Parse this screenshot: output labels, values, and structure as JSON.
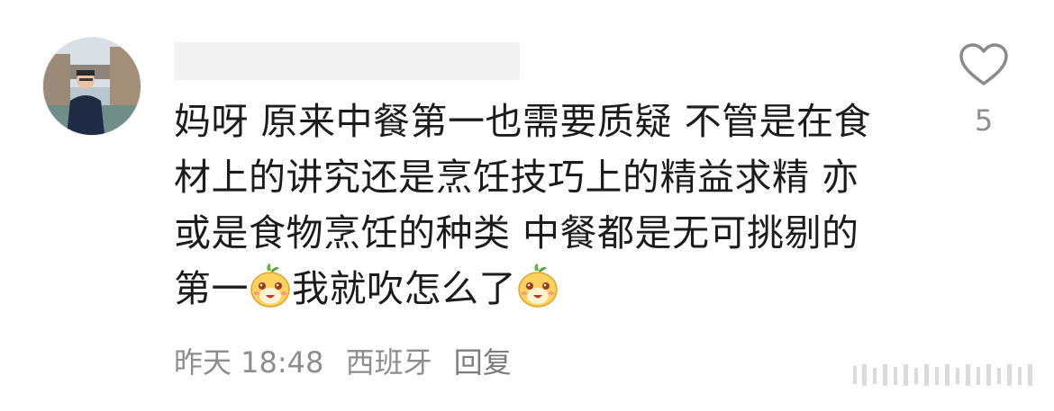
{
  "comment": {
    "text_lines": [
      "妈呀 原来中餐第一也需要质疑 不管是在食",
      "材上的讲究还是烹饪技巧上的精益求精 亦",
      "或是食物烹饪的种类 中餐都是无可挑剔的"
    ],
    "last_line_part1": "第一",
    "last_line_part2": "我就吹怎么了",
    "emoji_icon": "proud-face-emoji"
  },
  "meta": {
    "time": "昨天 18:48",
    "location": "西班牙",
    "reply": "回复"
  },
  "like": {
    "count": "5",
    "icon": "heart-outline-icon"
  },
  "colors": {
    "text": "#1c1c1c",
    "meta": "#8d8d8d"
  }
}
